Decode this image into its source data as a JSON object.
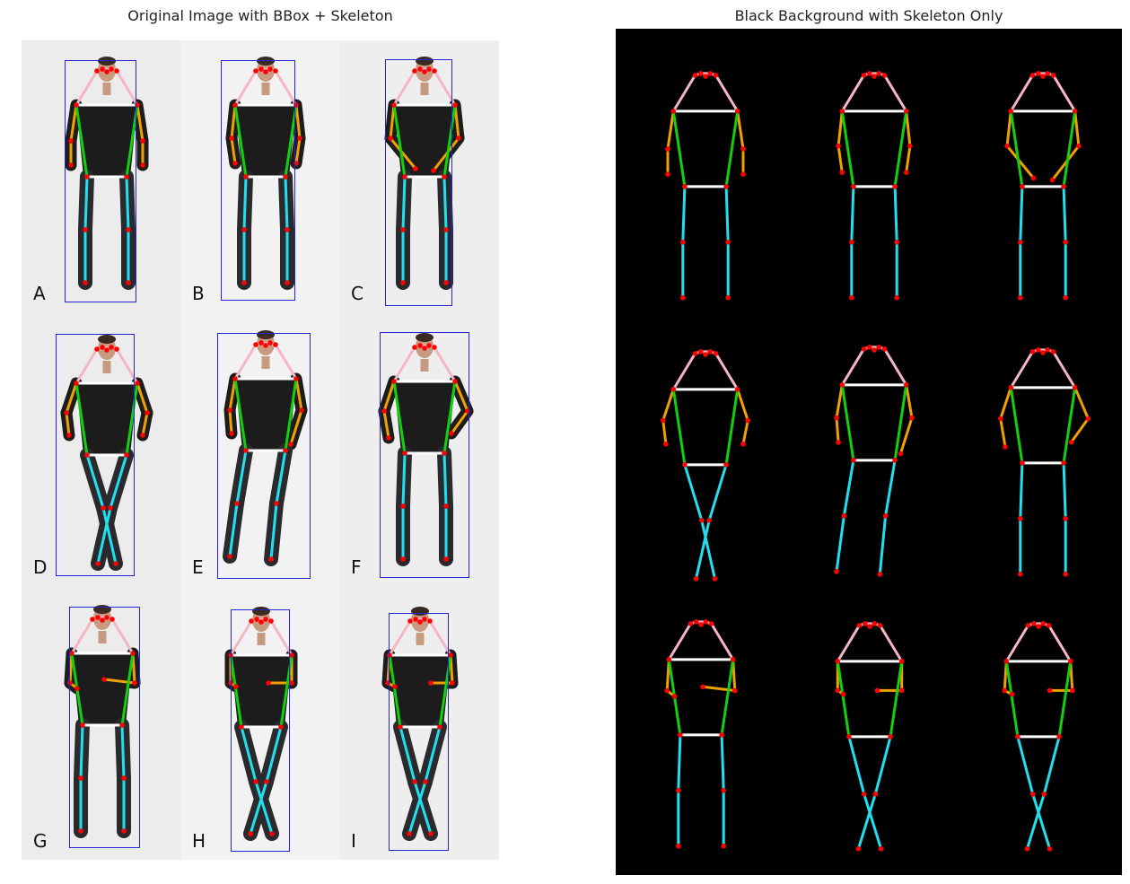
{
  "titles": {
    "left": "Original Image with BBox + Skeleton",
    "right": "Black Background with Skeleton Only"
  },
  "colors": {
    "bbox": "#2323d8",
    "head": "#f4b6c2",
    "shoulder_hip": "#ffffff",
    "arm": "#f0a000",
    "torso": "#10d010",
    "leg": "#20e0f0",
    "joint": "#ff0000",
    "person": "#1c1c1c",
    "photo_background": "#f0f0f0",
    "right_background": "#000000"
  },
  "panels": [
    {
      "label": "A",
      "pose": "arms down"
    },
    {
      "label": "B",
      "pose": "arms down"
    },
    {
      "label": "C",
      "pose": "hands clasped"
    },
    {
      "label": "D",
      "pose": "hands on hips, legs crossed"
    },
    {
      "label": "E",
      "pose": "hand in pocket"
    },
    {
      "label": "F",
      "pose": "hands on hips"
    },
    {
      "label": "G",
      "pose": "arms crossed"
    },
    {
      "label": "H",
      "pose": "arms crossed, legs crossed"
    },
    {
      "label": "I",
      "pose": "arms crossed, legs crossed"
    }
  ]
}
